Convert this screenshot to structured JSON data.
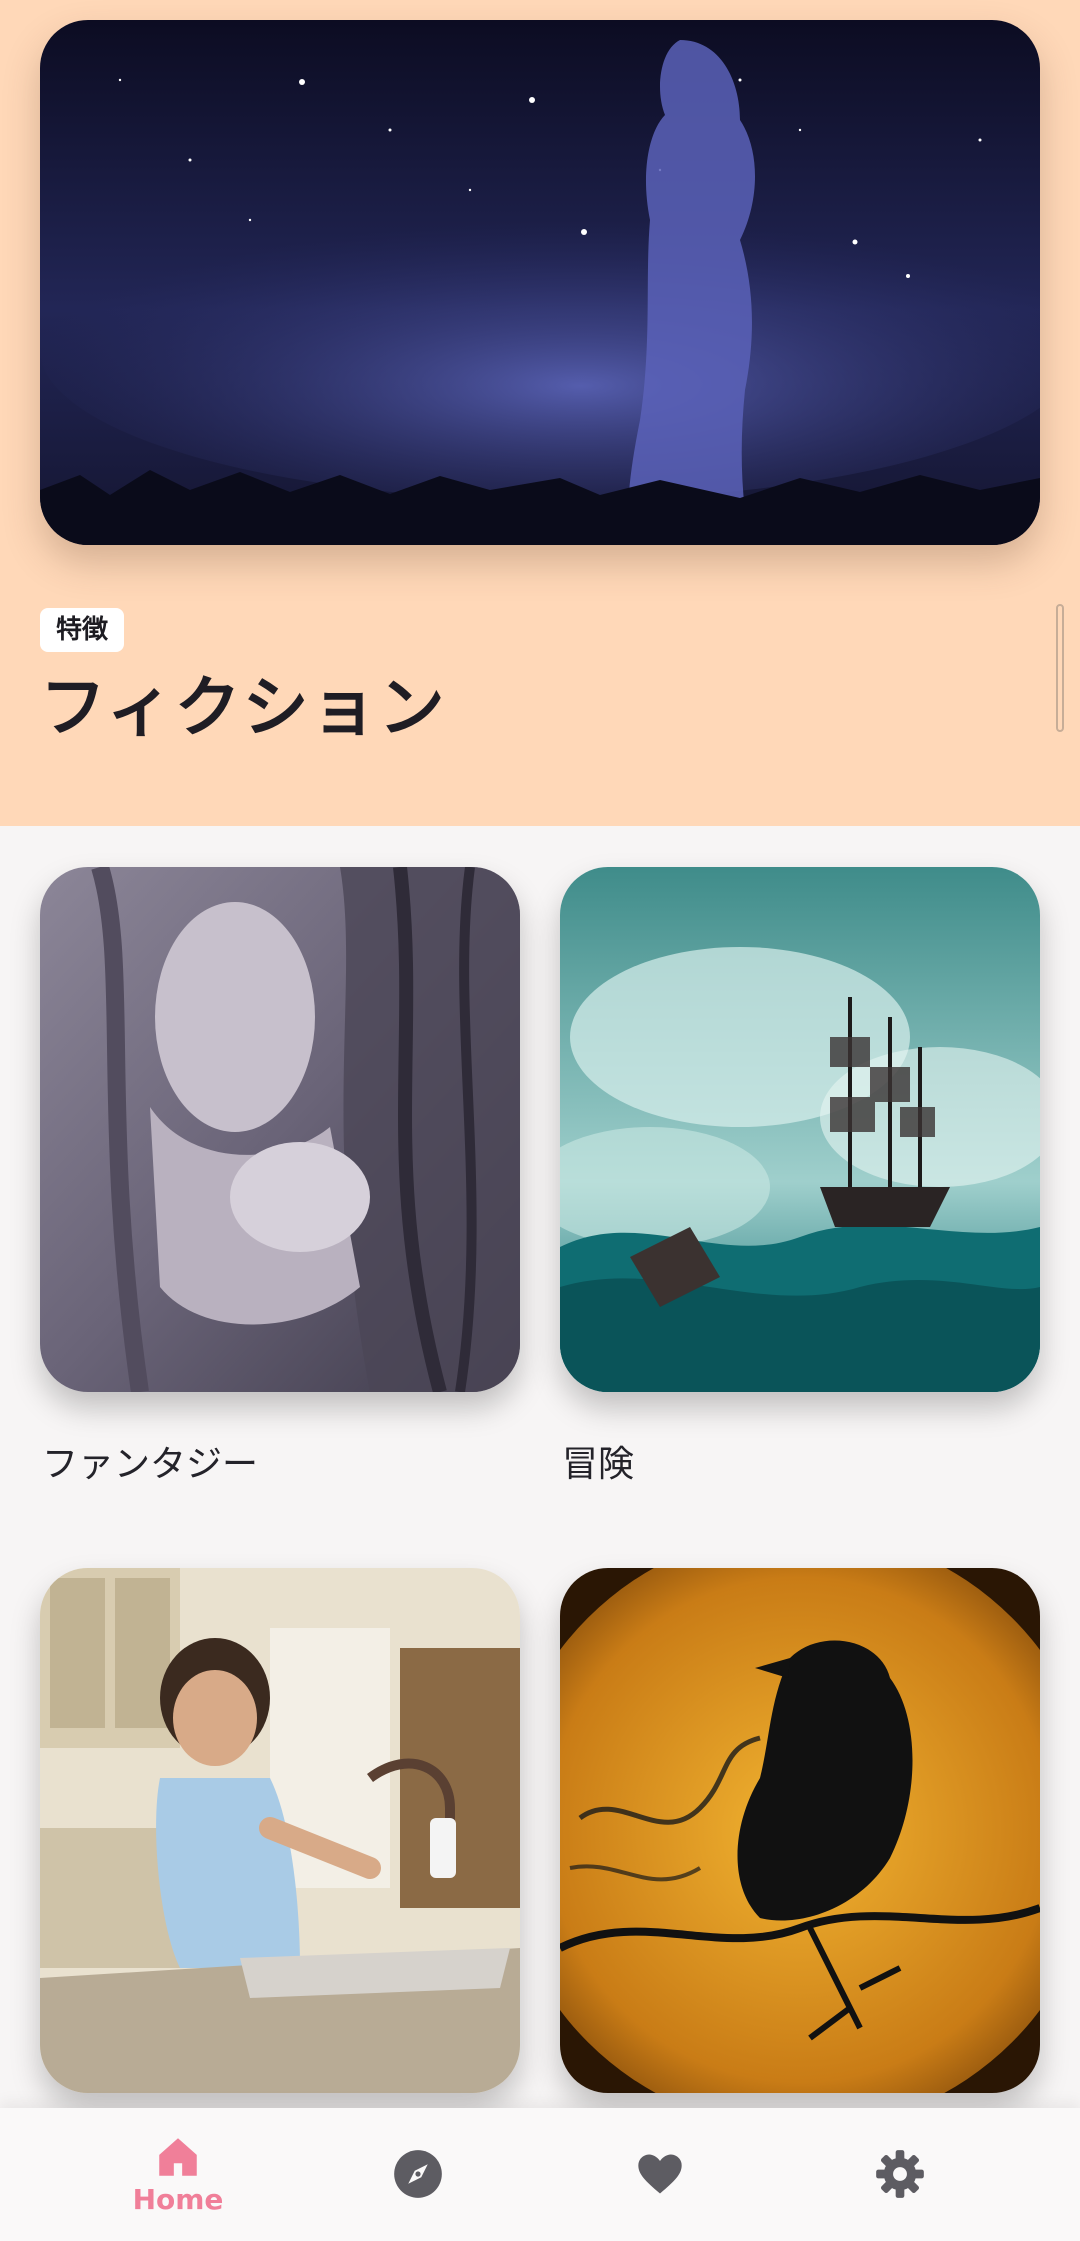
{
  "featured": {
    "badge": "特徴",
    "title": "フィクション",
    "image": "starry-woman-silhouette-image"
  },
  "categories": [
    {
      "label": "ファンタジー",
      "image": "stone-woman-tree-image"
    },
    {
      "label": "冒険",
      "image": "ship-in-storm-image"
    },
    {
      "label": "",
      "image": "boy-washing-hands-image"
    },
    {
      "label": "",
      "image": "raven-moon-image"
    }
  ],
  "bottom_nav": {
    "items": [
      {
        "name": "home",
        "label": "Home",
        "icon": "home-icon",
        "active": true
      },
      {
        "name": "explore",
        "label": "",
        "icon": "compass-icon",
        "active": false
      },
      {
        "name": "favorites",
        "label": "",
        "icon": "heart-icon",
        "active": false
      },
      {
        "name": "settings",
        "label": "",
        "icon": "gear-icon",
        "active": false
      }
    ],
    "active_color": "#f07f99",
    "inactive_color": "#5d5c62"
  },
  "colors": {
    "hero_background": "#ffd8b8",
    "page_background": "#f7f5f5"
  }
}
